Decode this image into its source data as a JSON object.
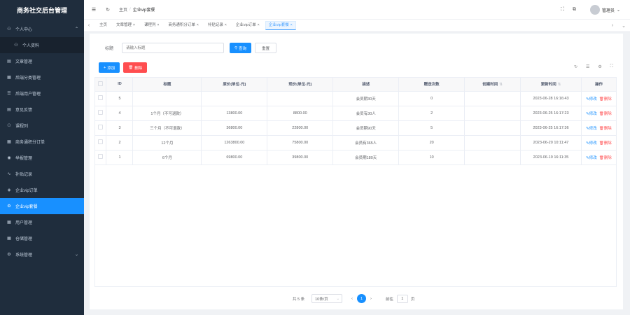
{
  "app": {
    "title": "商务社交后台管理"
  },
  "sidebar": {
    "items": [
      {
        "label": "个人中心",
        "icon": "user-icon",
        "arrow": "⌃",
        "active": false,
        "sub": false
      },
      {
        "label": "个人资料",
        "icon": "user-icon",
        "arrow": "",
        "active": false,
        "sub": true
      },
      {
        "label": "文章管理",
        "icon": "document-icon",
        "arrow": "",
        "active": false,
        "sub": false
      },
      {
        "label": "后端分类管理",
        "icon": "table-icon",
        "arrow": "",
        "active": false,
        "sub": false
      },
      {
        "label": "后端用户管理",
        "icon": "list-icon",
        "arrow": "",
        "active": false,
        "sub": false
      },
      {
        "label": "意见反馈",
        "icon": "document-icon",
        "arrow": "",
        "active": false,
        "sub": false
      },
      {
        "label": "课程列",
        "icon": "user-icon",
        "arrow": "",
        "active": false,
        "sub": false
      },
      {
        "label": "商务通积分订单",
        "icon": "table-icon",
        "arrow": "",
        "active": false,
        "sub": false
      },
      {
        "label": "举报管理",
        "icon": "eye-icon",
        "arrow": "",
        "active": false,
        "sub": false
      },
      {
        "label": "补贴记录",
        "icon": "chart-icon",
        "arrow": "",
        "active": false,
        "sub": false
      },
      {
        "label": "企业vip订单",
        "icon": "layer-icon",
        "arrow": "",
        "active": false,
        "sub": false
      },
      {
        "label": "企业vip套餐",
        "icon": "gear-icon",
        "arrow": "",
        "active": true,
        "sub": false
      },
      {
        "label": "用户管理",
        "icon": "table-icon",
        "arrow": "",
        "active": false,
        "sub": false
      },
      {
        "label": "仓储管理",
        "icon": "table-icon",
        "arrow": "",
        "active": false,
        "sub": false
      },
      {
        "label": "系统管理",
        "icon": "gear-icon",
        "arrow": "⌄",
        "active": false,
        "sub": false
      }
    ]
  },
  "header": {
    "breadcrumb": [
      "主页",
      "企业vip套餐"
    ],
    "user": "管理员",
    "user_arrow": "⌄"
  },
  "tags": {
    "items": [
      {
        "label": "主页",
        "closable": false,
        "active": false
      },
      {
        "label": "文章管理",
        "closable": true,
        "active": false
      },
      {
        "label": "课程列",
        "closable": true,
        "active": false
      },
      {
        "label": "商务通积分订单",
        "closable": true,
        "active": false
      },
      {
        "label": "补贴记录",
        "closable": true,
        "active": false
      },
      {
        "label": "企业vip订单",
        "closable": true,
        "active": false
      },
      {
        "label": "企业vip套餐",
        "closable": true,
        "active": true
      }
    ]
  },
  "search": {
    "label": "标题",
    "placeholder": "请输入标题",
    "search_label": "查询",
    "reset_label": "重置"
  },
  "toolbar": {
    "add_label": "添加",
    "delete_label": "删除"
  },
  "table": {
    "headers": [
      "",
      "ID",
      "标题",
      "原价(单位-元)",
      "现价(单位-元)",
      "描述",
      "赠送次数",
      "创建时间",
      "更新时间",
      "操作"
    ],
    "edit_label": "修改",
    "delete_label": "删除",
    "rows": [
      {
        "id": "5",
        "title": "",
        "orig": "",
        "price": "",
        "desc": "会员期30天",
        "times": "0",
        "created": "",
        "updated": "2023-06-28 16:16:43"
      },
      {
        "id": "4",
        "title": "1个月（不可退款）",
        "orig": "13800.00",
        "price": "8800.00",
        "desc": "会员有30人",
        "times": "2",
        "created": "",
        "updated": "2023-06-25 16:17:23"
      },
      {
        "id": "3",
        "title": "三个月（不可退款）",
        "orig": "36800.00",
        "price": "22800.00",
        "desc": "会员期90天",
        "times": "5",
        "created": "",
        "updated": "2023-06-25 16:17:36"
      },
      {
        "id": "2",
        "title": "12个月",
        "orig": "1263800.00",
        "price": "75800.00",
        "desc": "会员有365人",
        "times": "20",
        "created": "",
        "updated": "2023-06-20 10:11:47"
      },
      {
        "id": "1",
        "title": "6个月",
        "orig": "69800.00",
        "price": "39800.00",
        "desc": "会员期180天",
        "times": "10",
        "created": "",
        "updated": "2023-06-19 16:11:35"
      }
    ]
  },
  "pagination": {
    "total": "共 5 条",
    "page_size": "10条/页",
    "prev": "‹",
    "current": "1",
    "next": "›",
    "goto_label": "前往",
    "goto_value": "1",
    "pages_suffix": "页"
  },
  "colors": {
    "sidebar_bg": "#1f2d3d",
    "primary": "#1890ff",
    "danger": "#ff4d4f"
  }
}
